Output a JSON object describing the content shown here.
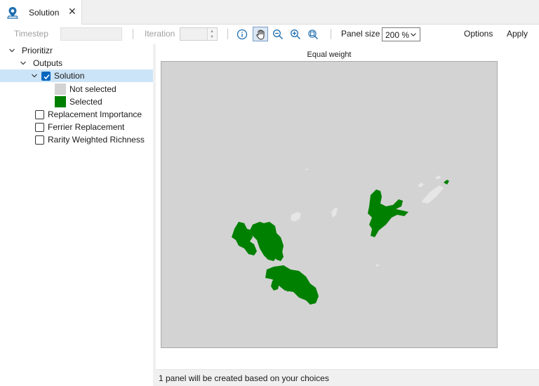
{
  "tab": {
    "title": "Solution",
    "icon": "map-pin-icon",
    "close_glyph": "✕"
  },
  "toolbar": {
    "timestep_label": "Timestep",
    "timestep_value": "",
    "iteration_label": "Iteration",
    "iteration_value": "",
    "tools": [
      "info-icon",
      "pan-hand-icon",
      "zoom-out-icon",
      "zoom-in-icon",
      "zoom-extent-icon"
    ],
    "active_tool": "pan-hand-icon",
    "panel_size_label": "Panel size",
    "panel_size_value": "200 %",
    "options_label": "Options",
    "apply_label": "Apply"
  },
  "tree": {
    "root": "Prioritizr",
    "outputs": "Outputs",
    "solution": {
      "label": "Solution",
      "checked": true
    },
    "legend": [
      {
        "label": "Not selected",
        "color": "#d3d3d3"
      },
      {
        "label": "Selected",
        "color": "#008000"
      }
    ],
    "items": [
      {
        "label": "Replacement Importance",
        "checked": false
      },
      {
        "label": "Ferrier Replacement",
        "checked": false
      },
      {
        "label": "Rarity Weighted Richness",
        "checked": false
      }
    ]
  },
  "map": {
    "panel_title": "Equal weight",
    "background_color": "#d3d3d3",
    "selected_color": "#008000",
    "not_selected_color": "#e6e6e6"
  },
  "status": {
    "text": "1 panel will be created based on your choices"
  }
}
